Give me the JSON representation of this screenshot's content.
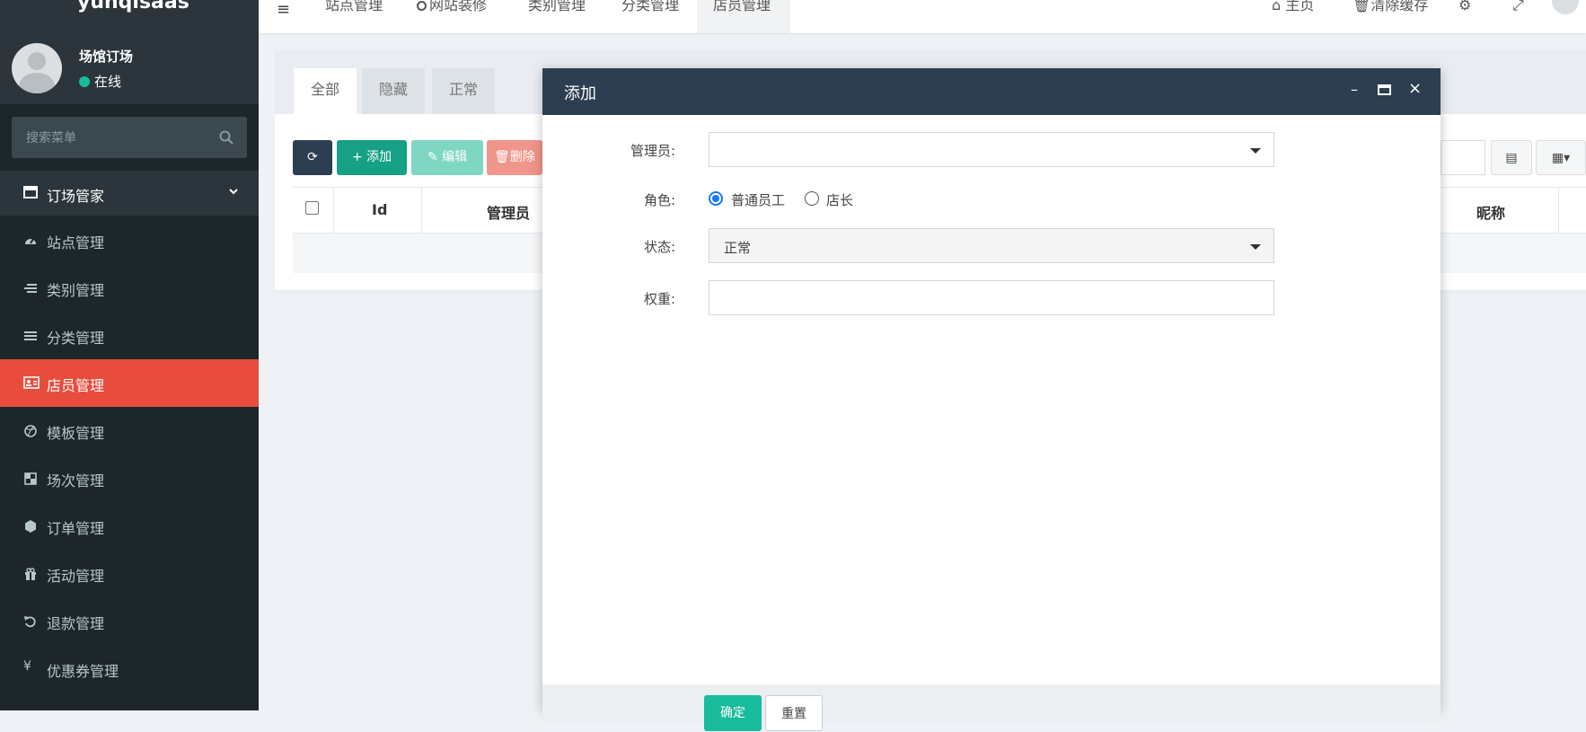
{
  "sidebar": {
    "brand": "yunqisaas",
    "user": {
      "name": "场馆订场",
      "status": "在线"
    },
    "search_placeholder": "搜索菜单",
    "section": "订场管家",
    "items": [
      {
        "label": "站点管理",
        "icon": "dashboard-icon"
      },
      {
        "label": "类别管理",
        "icon": "list-icon"
      },
      {
        "label": "分类管理",
        "icon": "bars-icon"
      },
      {
        "label": "店员管理",
        "icon": "id-card-icon",
        "active": true
      },
      {
        "label": "模板管理",
        "icon": "dribbble-icon"
      },
      {
        "label": "场次管理",
        "icon": "grid-icon"
      },
      {
        "label": "订单管理",
        "icon": "cube-icon"
      },
      {
        "label": "活动管理",
        "icon": "gift-icon"
      },
      {
        "label": "退款管理",
        "icon": "undo-icon"
      },
      {
        "label": "优惠券管理",
        "icon": "yen-icon"
      }
    ]
  },
  "topnav": {
    "tabs": [
      "站点管理",
      "网站装修",
      "类别管理",
      "分类管理",
      "店员管理"
    ],
    "active_tab": "店员管理",
    "right": {
      "home": "主页",
      "clear_cache": "清除缓存"
    }
  },
  "content": {
    "tabs": [
      "全部",
      "隐藏",
      "正常"
    ],
    "toolbar": {
      "add": "添加",
      "edit": "编辑",
      "delete": "删除"
    },
    "columns": {
      "id": "Id",
      "admin": "管理员",
      "nickname": "昵称"
    }
  },
  "modal": {
    "title": "添加",
    "fields": {
      "admin_label": "管理员:",
      "role_label": "角色:",
      "role_options": [
        "普通员工",
        "店长"
      ],
      "role_selected": "普通员工",
      "status_label": "状态:",
      "status_value": "正常",
      "weight_label": "权重:"
    },
    "footer": {
      "ok": "确定",
      "reset": "重置"
    }
  },
  "colors": {
    "sidebar_bg": "#1d262b",
    "active": "#e74c3c",
    "modal_header": "#2c3e50",
    "primary": "#18bc9c"
  }
}
